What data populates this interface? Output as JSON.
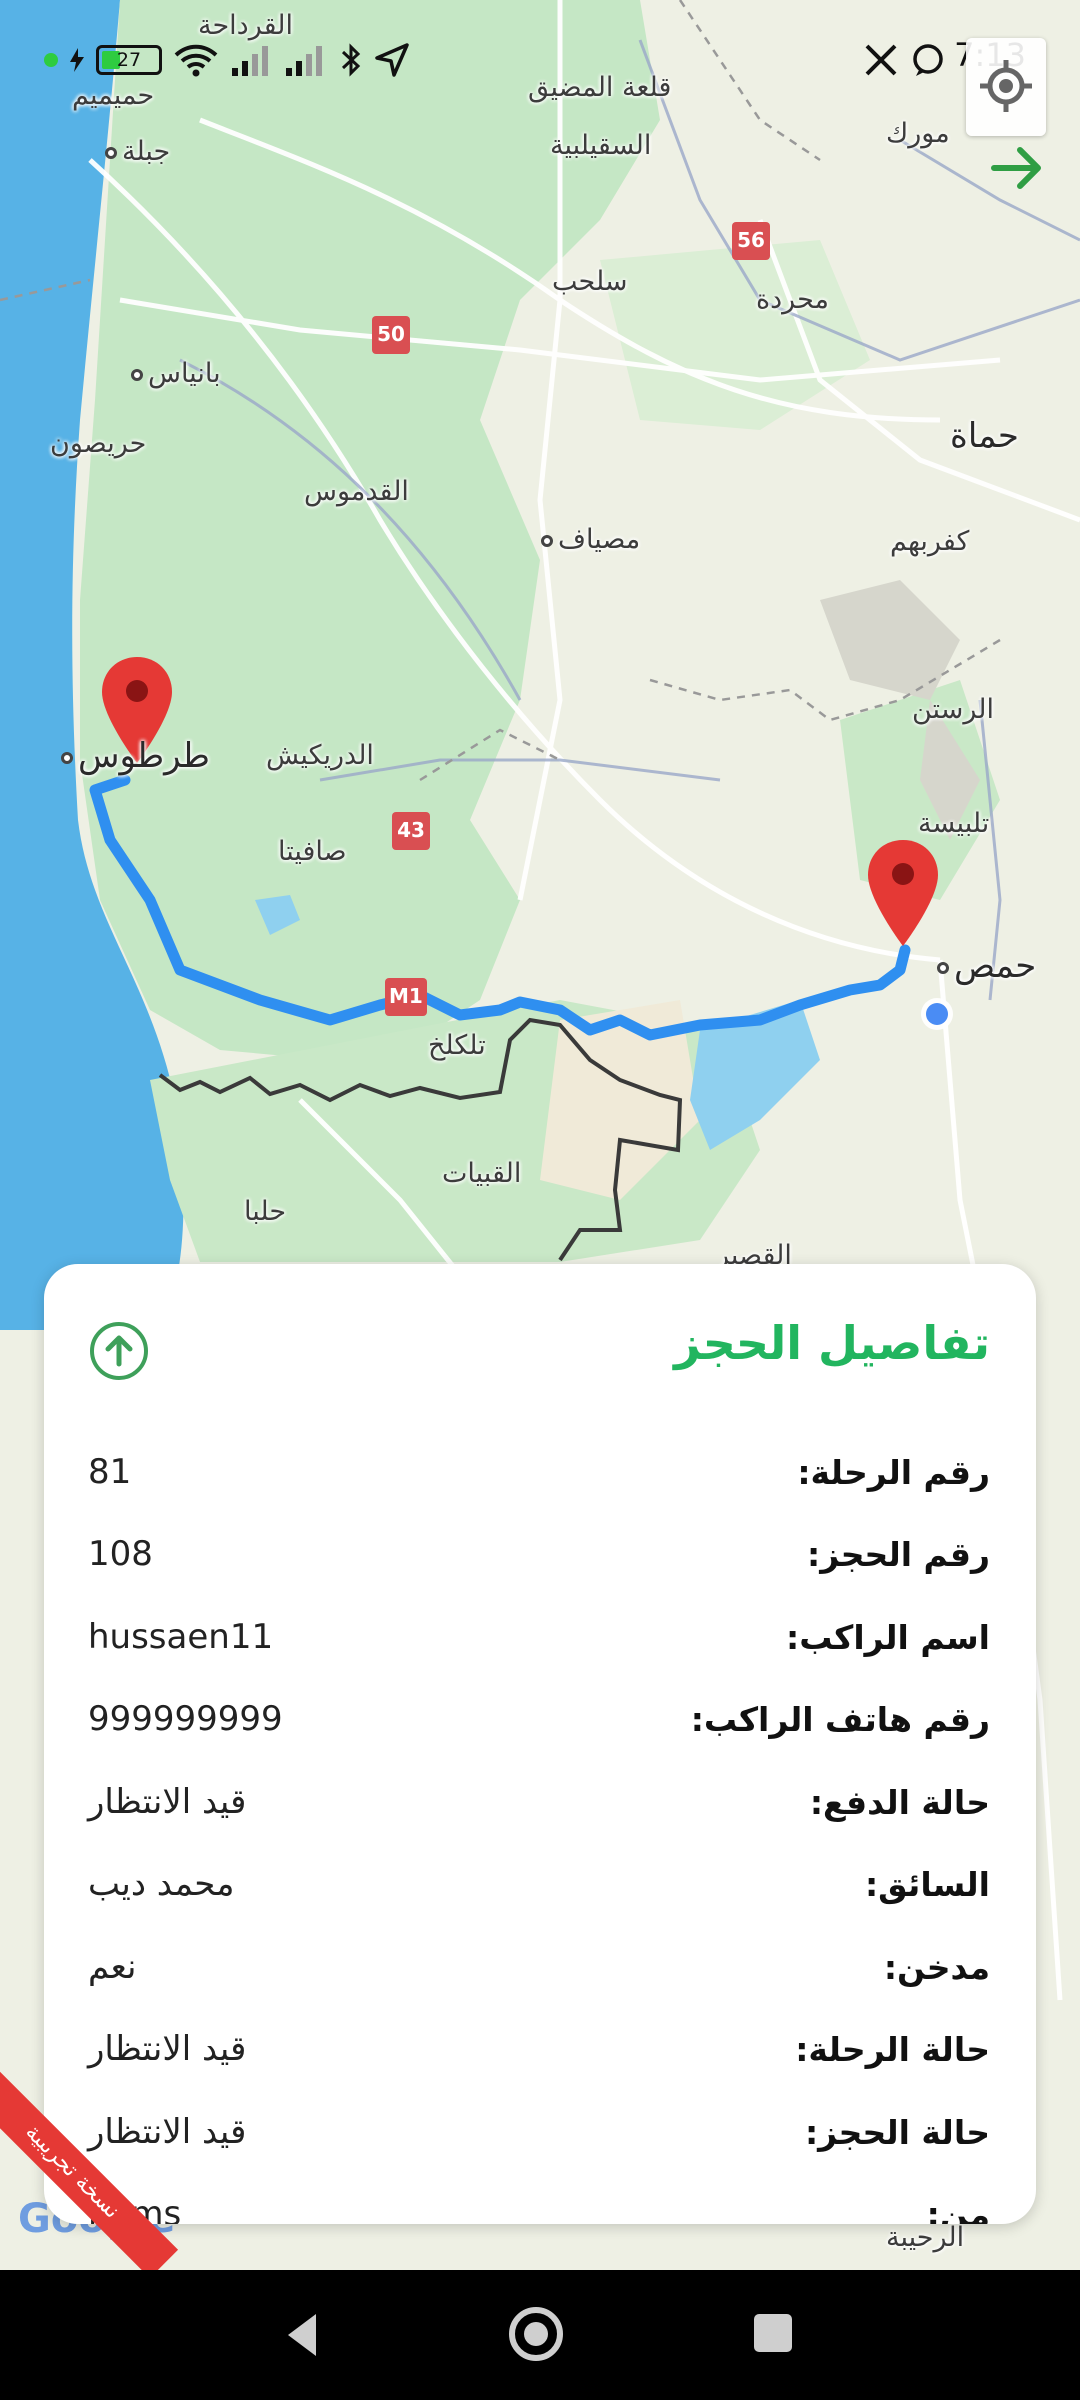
{
  "status_bar": {
    "time": "7:13",
    "battery": "27",
    "icons": [
      "wifi-icon",
      "signal-icon",
      "signal-icon",
      "bluetooth-icon",
      "location-arrow-icon",
      "x-app-icon",
      "message-icon"
    ]
  },
  "map": {
    "places": {
      "qardaha": "القرداحة",
      "humaymim": "حميميم",
      "jableh": "جبلة",
      "qalaat_madiq": "قلعة المضيق",
      "suqaylabiyah": "السقيلبية",
      "murak": "مورك",
      "salhab": "سلحب",
      "mahardah": "محردة",
      "baniyas": "بانياس",
      "hama": "حماة",
      "hraysoun": "حريصون",
      "qadmus": "القدموس",
      "masyaf": "مصياف",
      "kafr_buhum": "كفربهم",
      "rastan": "الرستن",
      "tartus": "طرطوس",
      "draykish": "الدريكيش",
      "safita": "صافيتا",
      "talbiseh": "تلبيسة",
      "homs": "حمص",
      "tall_kalakh": "تلكلخ",
      "qubayat": "القبيات",
      "halba": "حلبا",
      "qusayr": "القصير",
      "ruhaybah": "الرحيبة"
    },
    "shields": {
      "s56": "56",
      "s50": "50",
      "s43": "43",
      "m1": "M1"
    }
  },
  "sheet": {
    "title": "تفاصيل الحجز",
    "rows": [
      {
        "label": "رقم الرحلة:",
        "value": "81"
      },
      {
        "label": "رقم الحجز:",
        "value": "108"
      },
      {
        "label": "اسم الراكب:",
        "value": "hussaen11"
      },
      {
        "label": "رقم هاتف الراكب:",
        "value": "999999999"
      },
      {
        "label": "حالة الدفع:",
        "value": "قيد الانتظار"
      },
      {
        "label": "السائق:",
        "value": "محمد ديب"
      },
      {
        "label": "مدخن:",
        "value": "نعم"
      },
      {
        "label": "حالة الرحلة:",
        "value": "قيد الانتظار"
      },
      {
        "label": "حالة الحجز:",
        "value": "قيد الانتظار"
      },
      {
        "label": "من:",
        "value": "homs"
      }
    ]
  },
  "watermark": {
    "trial": "نسخة تجريبية",
    "google": "Google"
  },
  "colors": {
    "accent": "#22b55f",
    "route": "#2f8ff0",
    "pin": "#e53935"
  }
}
